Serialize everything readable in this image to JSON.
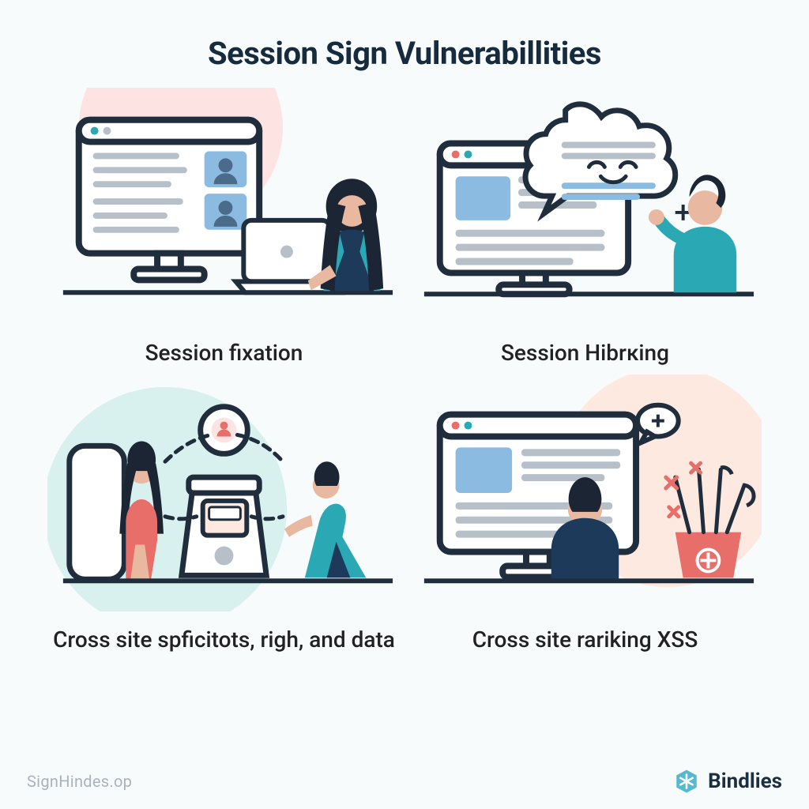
{
  "title": "Session Sign Vulnerabillities",
  "panels": [
    {
      "caption": "Session fixation"
    },
    {
      "caption": "Session Hibrкing"
    },
    {
      "caption": "Cross site spficitots, righ, and data"
    },
    {
      "caption": "Cross site rariking XSS"
    }
  ],
  "footer": {
    "site": "SignHindes.op",
    "brand": "Bindlies"
  },
  "colors": {
    "accent_pink": "#fde3e2",
    "accent_mint": "#d8f0ee",
    "accent_peach": "#fde9df",
    "stroke": "#1f2d3d",
    "teal": "#2aa9b5",
    "navy": "#1d3a5a",
    "skin": "#e8b9a0",
    "hair": "#1c2533",
    "coral": "#e86e6a",
    "skyblue": "#8bbbe0",
    "gray": "#b7c0c8"
  }
}
